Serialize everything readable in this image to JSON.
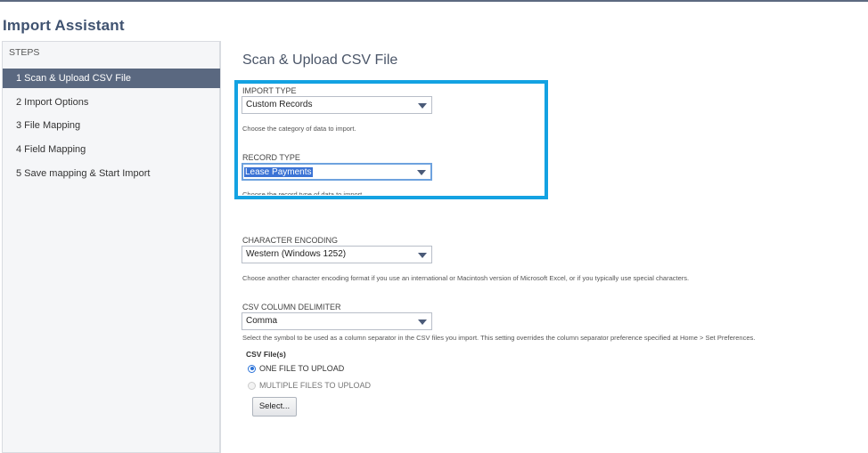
{
  "page": {
    "title": "Import Assistant"
  },
  "sidebar": {
    "heading": "STEPS",
    "items": [
      {
        "label": "1 Scan & Upload CSV File",
        "active": true
      },
      {
        "label": "2 Import Options"
      },
      {
        "label": "3 File Mapping"
      },
      {
        "label": "4 Field Mapping"
      },
      {
        "label": "5 Save mapping & Start Import"
      }
    ]
  },
  "main": {
    "title": "Scan & Upload CSV File",
    "import_type": {
      "label": "IMPORT TYPE",
      "value": "Custom Records",
      "help": "Choose the category of data to import."
    },
    "record_type": {
      "label": "RECORD TYPE",
      "value": "Lease Payments",
      "help": "Choose the record type of data to import."
    },
    "character_encoding": {
      "label": "CHARACTER ENCODING",
      "value": "Western (Windows 1252)",
      "help": "Choose another character encoding format if you use an international or Macintosh version of Microsoft Excel, or if you typically use special characters."
    },
    "csv_delimiter": {
      "label": "CSV COLUMN DELIMITER",
      "value": "Comma",
      "help": "Select the symbol to be used as a column separator in the CSV files you import. This setting overrides the column separator preference specified at Home > Set Preferences."
    },
    "csv_files": {
      "label": "CSV File(s)",
      "options": [
        {
          "label": "ONE FILE TO UPLOAD",
          "checked": true
        },
        {
          "label": "MULTIPLE FILES TO UPLOAD",
          "checked": false
        }
      ],
      "select_button": "Select..."
    }
  },
  "colors": {
    "highlight_border": "#13a2e2",
    "active_step_bg": "#5a6880",
    "title_color": "#3f5270"
  }
}
